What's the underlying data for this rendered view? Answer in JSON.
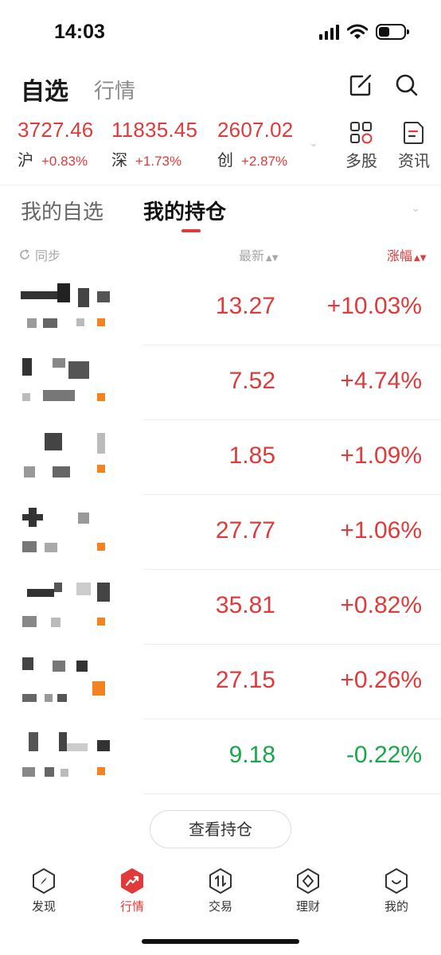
{
  "status_bar": {
    "time": "14:03"
  },
  "header": {
    "tab_watchlist": "自选",
    "tab_market": "行情"
  },
  "indices": [
    {
      "value": "3727.46",
      "name": "沪",
      "change": "+0.83%"
    },
    {
      "value": "11835.45",
      "name": "深",
      "change": "+1.73%"
    },
    {
      "value": "2607.02",
      "name": "创",
      "change": "+2.87%"
    }
  ],
  "quick_actions": {
    "multi_stock": "多股",
    "news": "资讯"
  },
  "section_tabs": {
    "my_watchlist": "我的自选",
    "my_holdings": "我的持仓"
  },
  "columns": {
    "sync": "同步",
    "latest": "最新",
    "change": "涨幅"
  },
  "holdings": [
    {
      "price": "13.27",
      "change": "+10.03%",
      "direction": "up"
    },
    {
      "price": "7.52",
      "change": "+4.74%",
      "direction": "up"
    },
    {
      "price": "1.85",
      "change": "+1.09%",
      "direction": "up"
    },
    {
      "price": "27.77",
      "change": "+1.06%",
      "direction": "up"
    },
    {
      "price": "35.81",
      "change": "+0.82%",
      "direction": "up"
    },
    {
      "price": "27.15",
      "change": "+0.26%",
      "direction": "up"
    },
    {
      "price": "9.18",
      "change": "-0.22%",
      "direction": "down"
    }
  ],
  "view_holdings_button": "查看持仓",
  "bottom_nav": {
    "discover": "发现",
    "market": "行情",
    "trade": "交易",
    "wealth": "理财",
    "mine": "我的",
    "active": "market"
  },
  "colors": {
    "up": "#e03a3a",
    "down": "#1aa64a",
    "accent": "#e03a3a",
    "pixelated_accent": "#f58220"
  }
}
